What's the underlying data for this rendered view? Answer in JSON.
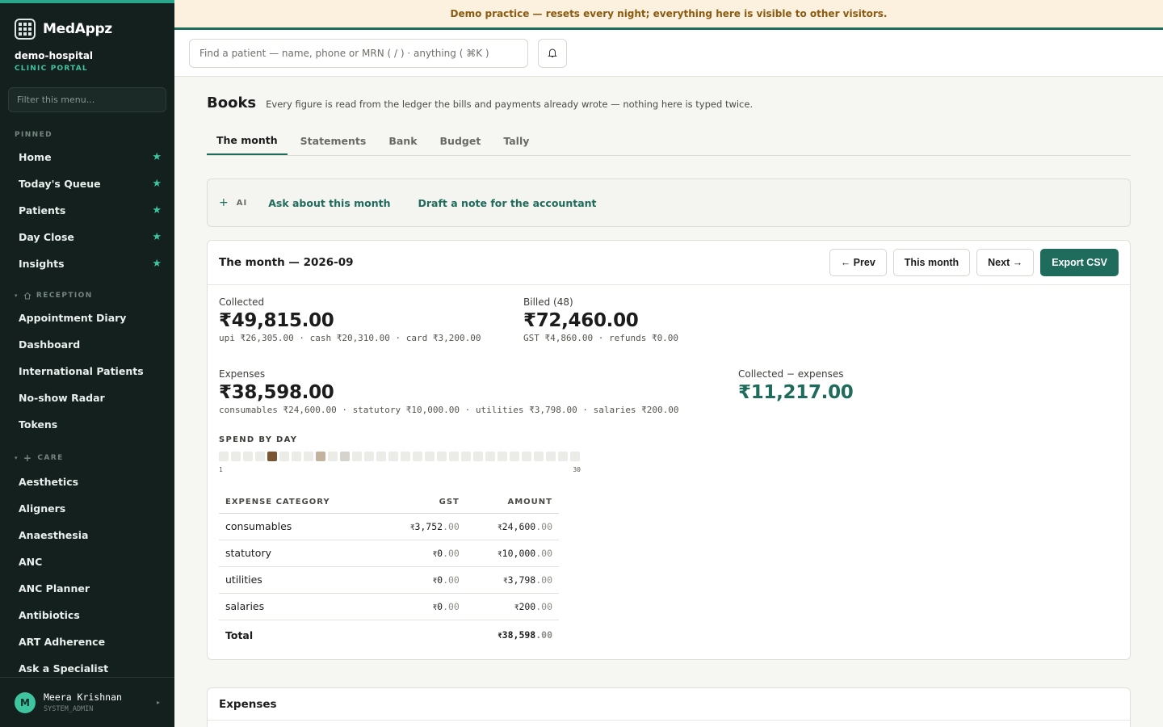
{
  "app": {
    "brand": "MedAppz",
    "org_name": "demo-hospital",
    "org_sub": "CLINIC PORTAL",
    "menu_filter_placeholder": "Filter this menu..."
  },
  "sidebar": {
    "pinned_label": "PINNED",
    "pinned": [
      {
        "label": "Home"
      },
      {
        "label": "Today's Queue"
      },
      {
        "label": "Patients"
      },
      {
        "label": "Day Close"
      },
      {
        "label": "Insights"
      }
    ],
    "reception_label": "RECEPTION",
    "reception": [
      {
        "label": "Appointment Diary"
      },
      {
        "label": "Dashboard"
      },
      {
        "label": "International Patients"
      },
      {
        "label": "No-show Radar"
      },
      {
        "label": "Tokens"
      }
    ],
    "care_label": "CARE",
    "care": [
      {
        "label": "Aesthetics"
      },
      {
        "label": "Aligners"
      },
      {
        "label": "Anaesthesia"
      },
      {
        "label": "ANC"
      },
      {
        "label": "ANC Planner"
      },
      {
        "label": "Antibiotics"
      },
      {
        "label": "ART Adherence"
      },
      {
        "label": "Ask a Specialist"
      }
    ],
    "user": {
      "initial": "M",
      "name": "Meera Krishnan",
      "role": "SYSTEM_ADMIN"
    }
  },
  "banner": "Demo practice — resets every night; everything here is visible to other visitors.",
  "topbar": {
    "search_placeholder": "Find a patient — name, phone or MRN ( / ) · anything ( ⌘K )"
  },
  "page": {
    "title": "Books",
    "subtitle": "Every figure is read from the ledger the bills and payments already wrote — nothing here is typed twice.",
    "tabs": [
      {
        "label": "The month",
        "active": true
      },
      {
        "label": "Statements"
      },
      {
        "label": "Bank"
      },
      {
        "label": "Budget"
      },
      {
        "label": "Tally"
      }
    ]
  },
  "ai": {
    "tag": "AI",
    "ask": "Ask about this month",
    "draft": "Draft a note for the accountant"
  },
  "month_card": {
    "title": "The month — 2026-09",
    "prev": "← Prev",
    "this_month": "This month",
    "next": "Next →",
    "export": "Export CSV",
    "collected": {
      "label": "Collected",
      "value": "₹49,815.00",
      "breakdown": "upi ₹26,305.00 · cash ₹20,310.00 · card ₹3,200.00"
    },
    "billed": {
      "label": "Billed (48)",
      "value": "₹72,460.00",
      "breakdown": "GST ₹4,860.00 · refunds ₹0.00"
    },
    "expenses": {
      "label": "Expenses",
      "value": "₹38,598.00",
      "breakdown": "consumables ₹24,600.00 · statutory ₹10,000.00 · utilities ₹3,798.00 · salaries ₹200.00"
    },
    "net": {
      "label": "Collected − expenses",
      "value": "₹11,217.00"
    },
    "spend_label": "SPEND BY DAY",
    "spend_days": {
      "first": "1",
      "last": "30"
    },
    "spend_by_day": [
      0,
      0,
      0,
      0,
      24600,
      0,
      0,
      0,
      10000,
      0,
      3998,
      0,
      0,
      0,
      0,
      0,
      0,
      0,
      0,
      0,
      0,
      0,
      0,
      0,
      0,
      0,
      0,
      0,
      0,
      0
    ],
    "colors": {
      "accent": "#1f6b5c",
      "heat_high": "#7b5532",
      "heat_mid": "#c2b29e",
      "heat_low": "#d6d3cd",
      "heat_none": "#ebebe7"
    },
    "table": {
      "headers": {
        "category": "EXPENSE CATEGORY",
        "gst": "GST",
        "amount": "AMOUNT"
      },
      "rows": [
        {
          "category": "consumables",
          "gst": "3,752",
          "gst_dec": ".00",
          "amount": "24,600",
          "amount_dec": ".00"
        },
        {
          "category": "statutory",
          "gst": "0",
          "gst_dec": ".00",
          "amount": "10,000",
          "amount_dec": ".00"
        },
        {
          "category": "utilities",
          "gst": "0",
          "gst_dec": ".00",
          "amount": "3,798",
          "amount_dec": ".00"
        },
        {
          "category": "salaries",
          "gst": "0",
          "gst_dec": ".00",
          "amount": "200",
          "amount_dec": ".00"
        }
      ],
      "total": {
        "label": "Total",
        "amount": "38,598",
        "amount_dec": ".00"
      },
      "currency": "₹"
    }
  },
  "expenses_card": {
    "title": "Expenses"
  }
}
